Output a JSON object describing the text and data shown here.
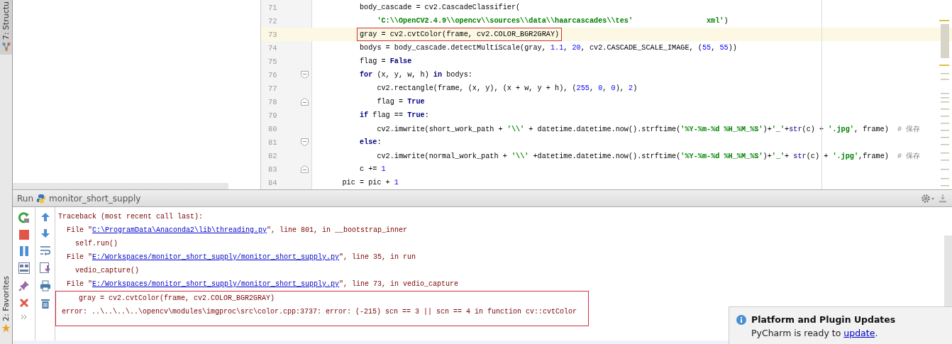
{
  "tool_tabs": [
    {
      "label": "7: Structu",
      "selected": true,
      "kind": "structure"
    },
    {
      "label": "2: Favorites",
      "selected": false,
      "kind": "favorites"
    }
  ],
  "editor": {
    "lines": [
      {
        "number": "71",
        "current": false,
        "boxed": false,
        "fold_open": false,
        "fold_close": false,
        "segments": [
          {
            "kind": "code",
            "text": "        body_cascade = cv2.CascadeClassifier("
          }
        ]
      },
      {
        "number": "72",
        "current": false,
        "boxed": false,
        "fold_open": false,
        "fold_close": false,
        "segments": [
          {
            "kind": "str",
            "text": "            'C:\\\\OpenCV2.4.9\\\\opencv\\\\sources\\\\data\\\\haarcascades\\\\tes'"
          },
          {
            "kind": "str",
            "text": "                 xml'"
          },
          {
            "kind": "code",
            "text": ")"
          }
        ]
      },
      {
        "number": "73",
        "current": true,
        "boxed": true,
        "fold_open": false,
        "fold_close": false,
        "segments": [
          {
            "kind": "code",
            "text": "        gray = cv2.cvtColor(frame, cv2.COLOR_BGR2GRAY)"
          }
        ]
      },
      {
        "number": "74",
        "current": false,
        "boxed": false,
        "fold_open": false,
        "fold_close": false,
        "segments": [
          {
            "kind": "code",
            "text": "        bodys = body_cascade.detectMultiScale(gray, "
          },
          {
            "kind": "num",
            "text": "1.1"
          },
          {
            "kind": "code",
            "text": ", "
          },
          {
            "kind": "num",
            "text": "20"
          },
          {
            "kind": "code",
            "text": ", cv2.CASCADE_SCALE_IMAGE, ("
          },
          {
            "kind": "num",
            "text": "55"
          },
          {
            "kind": "code",
            "text": ", "
          },
          {
            "kind": "num",
            "text": "55"
          },
          {
            "kind": "code",
            "text": "))"
          }
        ]
      },
      {
        "number": "75",
        "current": false,
        "boxed": false,
        "fold_open": false,
        "fold_close": false,
        "segments": [
          {
            "kind": "code",
            "text": "        flag = "
          },
          {
            "kind": "kw",
            "text": "False"
          }
        ]
      },
      {
        "number": "76",
        "current": false,
        "boxed": false,
        "fold_open": true,
        "fold_close": false,
        "segments": [
          {
            "kind": "kw",
            "text": "        for"
          },
          {
            "kind": "code",
            "text": " (x, y, w, h) "
          },
          {
            "kind": "kw",
            "text": "in"
          },
          {
            "kind": "code",
            "text": " bodys:"
          }
        ]
      },
      {
        "number": "77",
        "current": false,
        "boxed": false,
        "fold_open": false,
        "fold_close": false,
        "segments": [
          {
            "kind": "code",
            "text": "            cv2.rectangle(frame, (x, y), (x + w, y + h), ("
          },
          {
            "kind": "num",
            "text": "255"
          },
          {
            "kind": "code",
            "text": ", "
          },
          {
            "kind": "num",
            "text": "0"
          },
          {
            "kind": "code",
            "text": ", "
          },
          {
            "kind": "num",
            "text": "0"
          },
          {
            "kind": "code",
            "text": "), "
          },
          {
            "kind": "num",
            "text": "2"
          },
          {
            "kind": "code",
            "text": ")"
          }
        ]
      },
      {
        "number": "78",
        "current": false,
        "boxed": false,
        "fold_open": false,
        "fold_close": true,
        "segments": [
          {
            "kind": "code",
            "text": "            flag = "
          },
          {
            "kind": "kw",
            "text": "True"
          }
        ]
      },
      {
        "number": "79",
        "current": false,
        "boxed": false,
        "fold_open": false,
        "fold_close": false,
        "segments": [
          {
            "kind": "kw",
            "text": "        if"
          },
          {
            "kind": "code",
            "text": " flag == "
          },
          {
            "kind": "kw",
            "text": "True"
          },
          {
            "kind": "code",
            "text": ":"
          }
        ]
      },
      {
        "number": "80",
        "current": false,
        "boxed": false,
        "fold_open": false,
        "fold_close": false,
        "segments": [
          {
            "kind": "code",
            "text": "            cv2.imwrite(short_work_path + "
          },
          {
            "kind": "str",
            "text": "'\\\\'"
          },
          {
            "kind": "code",
            "text": " + datetime.datetime.now().strftime("
          },
          {
            "kind": "str",
            "text": "'%Y-%m-%d %H_%M_%S'"
          },
          {
            "kind": "code",
            "text": ")+"
          },
          {
            "kind": "str",
            "text": "'_'"
          },
          {
            "kind": "code",
            "text": "+"
          },
          {
            "kind": "builtin",
            "text": "str"
          },
          {
            "kind": "code",
            "text": "(c) + "
          },
          {
            "kind": "str",
            "text": "'.jpg'"
          },
          {
            "kind": "code",
            "text": ", frame)  "
          },
          {
            "kind": "comment",
            "text": "# 保存"
          }
        ]
      },
      {
        "number": "81",
        "current": false,
        "boxed": false,
        "fold_open": true,
        "fold_close": false,
        "segments": [
          {
            "kind": "kw",
            "text": "        else"
          },
          {
            "kind": "code",
            "text": ":"
          }
        ]
      },
      {
        "number": "82",
        "current": false,
        "boxed": false,
        "fold_open": false,
        "fold_close": false,
        "segments": [
          {
            "kind": "code",
            "text": "            cv2.imwrite(normal_work_path + "
          },
          {
            "kind": "str",
            "text": "'\\\\'"
          },
          {
            "kind": "code",
            "text": " +datetime.datetime.now().strftime("
          },
          {
            "kind": "str",
            "text": "'%Y-%m-%d %H_%M_%S'"
          },
          {
            "kind": "code",
            "text": ")+"
          },
          {
            "kind": "str",
            "text": "'_'"
          },
          {
            "kind": "code",
            "text": "+ "
          },
          {
            "kind": "builtin",
            "text": "str"
          },
          {
            "kind": "code",
            "text": "(c) + "
          },
          {
            "kind": "str",
            "text": "'.jpg'"
          },
          {
            "kind": "code",
            "text": ",frame)  "
          },
          {
            "kind": "comment",
            "text": "# 保存"
          }
        ]
      },
      {
        "number": "83",
        "current": false,
        "boxed": false,
        "fold_open": false,
        "fold_close": true,
        "segments": [
          {
            "kind": "code",
            "text": "        c += "
          },
          {
            "kind": "num",
            "text": "1"
          }
        ]
      },
      {
        "number": "84",
        "current": false,
        "boxed": false,
        "fold_open": false,
        "fold_close": false,
        "segments": [
          {
            "kind": "code",
            "text": "    pic = pic + "
          },
          {
            "kind": "num",
            "text": "1"
          }
        ]
      }
    ]
  },
  "run_panel": {
    "label": "Run",
    "config": "monitor_short_supply",
    "console": [
      {
        "boxed": false,
        "segments": [
          {
            "kind": "text",
            "text": "Traceback (most recent call last):"
          }
        ]
      },
      {
        "boxed": false,
        "segments": [
          {
            "kind": "text",
            "text": "  File \""
          },
          {
            "kind": "link",
            "text": "C:\\ProgramData\\Anaconda2\\lib\\threading.py"
          },
          {
            "kind": "text",
            "text": "\", line 801, in __bootstrap_inner"
          }
        ]
      },
      {
        "boxed": false,
        "segments": [
          {
            "kind": "text",
            "text": "    self.run()"
          }
        ]
      },
      {
        "boxed": false,
        "segments": [
          {
            "kind": "text",
            "text": "  File \""
          },
          {
            "kind": "link",
            "text": "E:/Workspaces/monitor_short_supply/monitor_short_supply.py"
          },
          {
            "kind": "text",
            "text": "\", line 35, in run"
          }
        ]
      },
      {
        "boxed": false,
        "segments": [
          {
            "kind": "text",
            "text": "    vedio_capture()"
          }
        ]
      },
      {
        "boxed": false,
        "segments": [
          {
            "kind": "text",
            "text": "  File \""
          },
          {
            "kind": "link",
            "text": "E:/Workspaces/monitor_short_supply/monitor_short_supply.py"
          },
          {
            "kind": "text",
            "text": "\", line 73, in vedio_capture"
          }
        ]
      },
      {
        "boxed": true,
        "segments": [
          {
            "kind": "text",
            "text": "    gray = cv2.cvtColor(frame, cv2.COLOR_BGR2GRAY)"
          }
        ]
      },
      {
        "boxed": true,
        "segments": [
          {
            "kind": "text",
            "text": "error: ..\\..\\..\\..\\opencv\\modules\\imgproc\\src\\color.cpp:3737: error: (-215) scn == 3 || scn == 4 in function cv::cvtColor"
          }
        ]
      }
    ]
  },
  "notification": {
    "title": "Platform and Plugin Updates",
    "body": "PyCharm is ready to ",
    "link": "update",
    "after": "."
  }
}
